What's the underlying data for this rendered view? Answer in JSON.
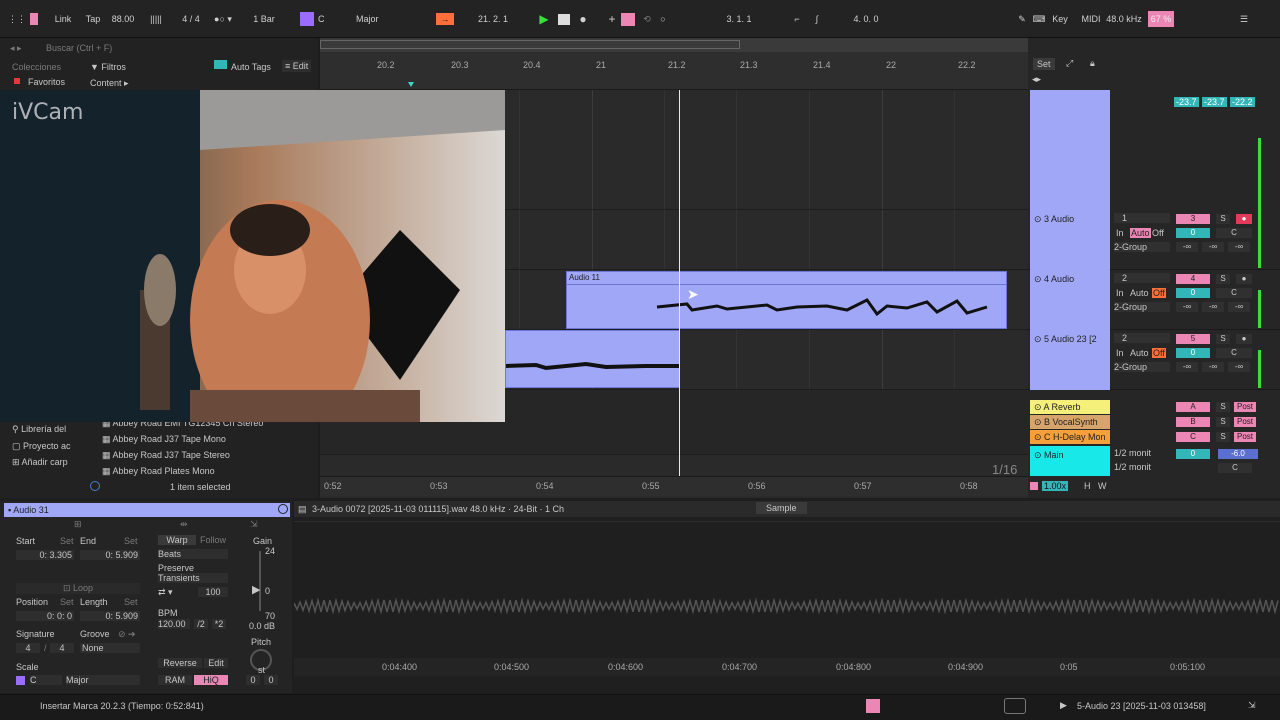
{
  "transport": {
    "link": "Link",
    "tap": "Tap",
    "tempo": "88.00",
    "meter": "4 / 4",
    "quantize": "1 Bar",
    "key": "C",
    "scale": "Major",
    "position": "21.   2.   1",
    "loop_start": "3.   1.   1",
    "loop_length": "4.   0.   0",
    "key_label": "Key",
    "midi_label": "MIDI",
    "sample_rate": "48.0 kHz",
    "cpu": "67 %"
  },
  "browser": {
    "search_placeholder": "Buscar (Ctrl + F)",
    "collections_label": "Colecciones",
    "favorites_label": "Favoritos",
    "filters_label": "Filtros",
    "auto_tags_label": "Auto Tags",
    "edit_label": "Edit",
    "content_label": "Content ▸",
    "places": [
      "Librería del",
      "Proyecto ac",
      "Añadir carp"
    ],
    "items": [
      "Abbey Road EMI TG12345 Ch Stereo",
      "Abbey Road J37 Tape Mono",
      "Abbey Road J37 Tape Stereo",
      "Abbey Road Plates Mono"
    ],
    "selection_status": "1 item selected"
  },
  "webcam": {
    "watermark": "iVCam"
  },
  "arrangement": {
    "bar_ticks": [
      "20.2",
      "20.3",
      "20.4",
      "21",
      "21.2",
      "21.3",
      "21.4",
      "22",
      "22.2"
    ],
    "time_ticks": [
      "0:52",
      "0:53",
      "0:54",
      "0:55",
      "0:56",
      "0:57",
      "0:58"
    ],
    "clip_name": "Audio 11",
    "grid_label": "1/16",
    "set_label": "Set"
  },
  "mixer": {
    "meters_top": [
      "-23.7",
      "-23.7",
      "-22.2"
    ],
    "tracks": [
      {
        "name": "3 Audio",
        "input": "1",
        "num": "3",
        "group": "2-Group",
        "vol": "0",
        "pan": "C",
        "in": "In",
        "auto": "Auto",
        "off": "Off",
        "send": "-∞"
      },
      {
        "name": "4 Audio",
        "input": "2",
        "num": "4",
        "group": "2-Group",
        "vol": "0",
        "pan": "C",
        "in": "In",
        "auto": "Auto",
        "off": "Off",
        "send": "-∞"
      },
      {
        "name": "5 Audio 23 [2",
        "input": "2",
        "num": "5",
        "group": "2-Group",
        "vol": "0",
        "pan": "C",
        "in": "In",
        "auto": "Auto",
        "off": "Off",
        "send": "-∞"
      }
    ],
    "returns": [
      {
        "name": "A Reverb",
        "letter": "A",
        "post": "Post"
      },
      {
        "name": "B VocalSynth",
        "letter": "B",
        "post": "Post"
      },
      {
        "name": "C H-Delay Mon",
        "letter": "C",
        "post": "Post"
      }
    ],
    "main": {
      "name": "Main",
      "out1": "1/2 monit",
      "out2": "1/2 monit",
      "vol": "0",
      "level": "-6.0",
      "pan": "C"
    },
    "zoom": "1.00x",
    "h_label": "H",
    "w_label": "W",
    "solo": "S"
  },
  "clip": {
    "name": "Audio 31",
    "start_label": "Start",
    "end_label": "End",
    "set_label": "Set",
    "start_value": "0:    3.305",
    "end_value": "0:    5.909",
    "loop_label": "Loop",
    "position_label": "Position",
    "length_label": "Length",
    "position_value": "0:    0:    0",
    "length_value": "0:    5.909",
    "signature_label": "Signature",
    "groove_label": "Groove",
    "sig_num": "4",
    "sig_den": "4",
    "groove_value": "None",
    "scale_label": "Scale",
    "scale_key": "C",
    "scale_mode": "Major",
    "warp_label": "Warp",
    "follow_label": "Follow",
    "warp_mode": "Beats",
    "preserve_label": "Preserve",
    "preserve_value": "Transients",
    "loop_pct": "100",
    "bpm_label": "BPM",
    "bpm_value": "120.00",
    "half": "/2",
    "double": "*2",
    "reverse_label": "Reverse",
    "edit_label": "Edit",
    "ram_label": "RAM",
    "hiq_label": "HiQ",
    "gain_label": "Gain",
    "gain_max": "24",
    "gain_zero": "0",
    "gain_min": "70",
    "gain_value": "0.0 dB",
    "pitch_label": "Pitch",
    "pitch_unit": "st",
    "pitch_st": "0",
    "pitch_ct": "0"
  },
  "sample": {
    "file_info": "3-Audio 0072 [2025-11-03 011115].wav  48.0 kHz · 24-Bit · 1 Ch",
    "tab_label": "Sample",
    "time_ticks": [
      "0:04:400",
      "0:04:500",
      "0:04:600",
      "0:04:700",
      "0:04:800",
      "0:04:900",
      "0:05",
      "0:05:100"
    ]
  },
  "status": {
    "message": "Insertar Marca 20.2.3 (Tiempo: 0:52:841)",
    "track_name": "5-Audio 23 [2025-11-03 013458]"
  },
  "colors": {
    "clip": "#a0a7f7",
    "accent_pink": "#ec86b5",
    "accent_teal": "#33b6b8",
    "accent_orange": "#ff6f3a",
    "return_yellow": "#f5f07a",
    "main_cyan": "#19e8e8"
  }
}
